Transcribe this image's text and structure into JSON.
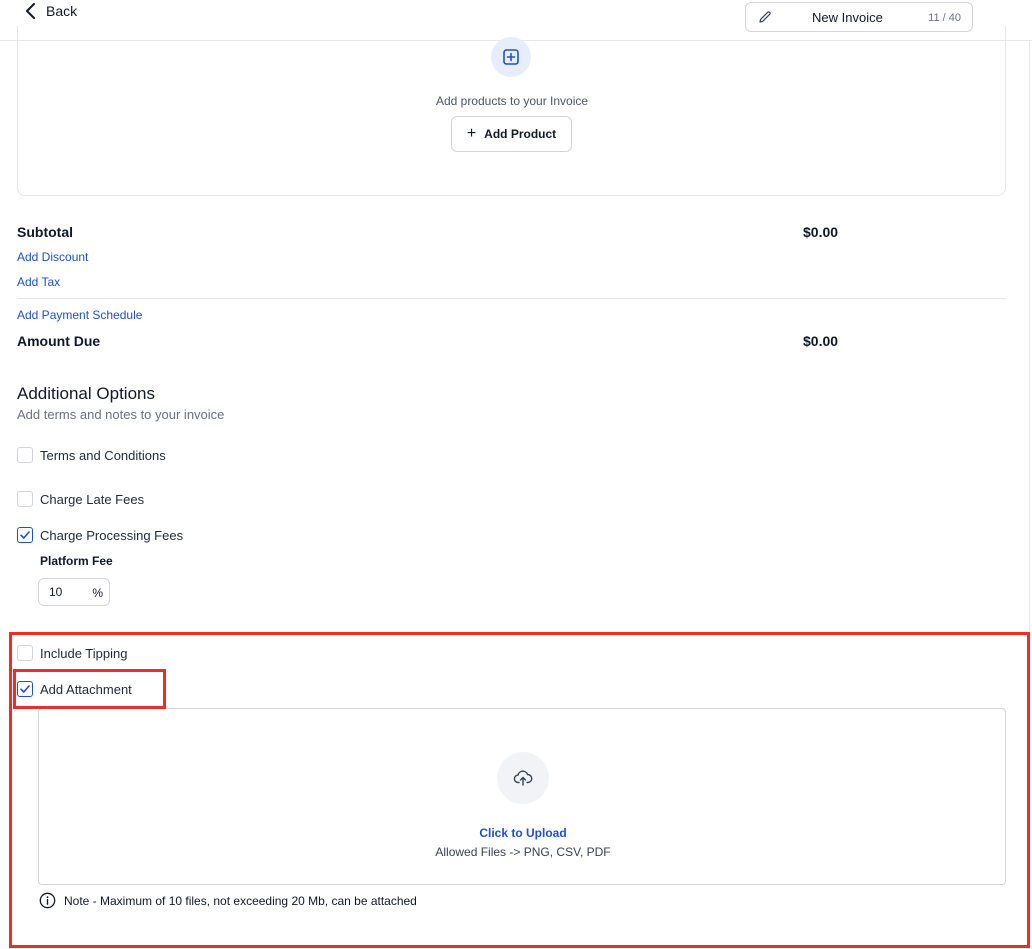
{
  "header": {
    "back_label": "Back",
    "title": "New Invoice",
    "title_count": "11 / 40"
  },
  "products": {
    "prompt": "Add products to your Invoice",
    "add_product_label": "Add Product"
  },
  "totals": {
    "subtotal_label": "Subtotal",
    "subtotal_value": "$0.00",
    "add_discount": "Add Discount",
    "add_tax": "Add Tax",
    "add_payment_schedule": "Add Payment Schedule",
    "amount_due_label": "Amount Due",
    "amount_due_value": "$0.00"
  },
  "additional": {
    "title": "Additional Options",
    "subtitle": "Add terms and notes to your invoice",
    "options": [
      {
        "label": "Terms and Conditions",
        "checked": false
      },
      {
        "label": "Charge Late Fees",
        "checked": false
      },
      {
        "label": "Charge Processing Fees",
        "checked": true
      },
      {
        "label": "Include Tipping",
        "checked": false
      },
      {
        "label": "Add Attachment",
        "checked": true
      }
    ],
    "platform_fee_label": "Platform Fee",
    "platform_fee_value": "10",
    "platform_fee_unit": "%"
  },
  "upload": {
    "click_label": "Click to Upload",
    "allowed": "Allowed Files -> PNG, CSV, PDF",
    "note": "Note - Maximum of 10 files, not exceeding 20 Mb, can be attached"
  },
  "colors": {
    "accent": "#1d4ed8",
    "highlight": "#ef2d24"
  }
}
